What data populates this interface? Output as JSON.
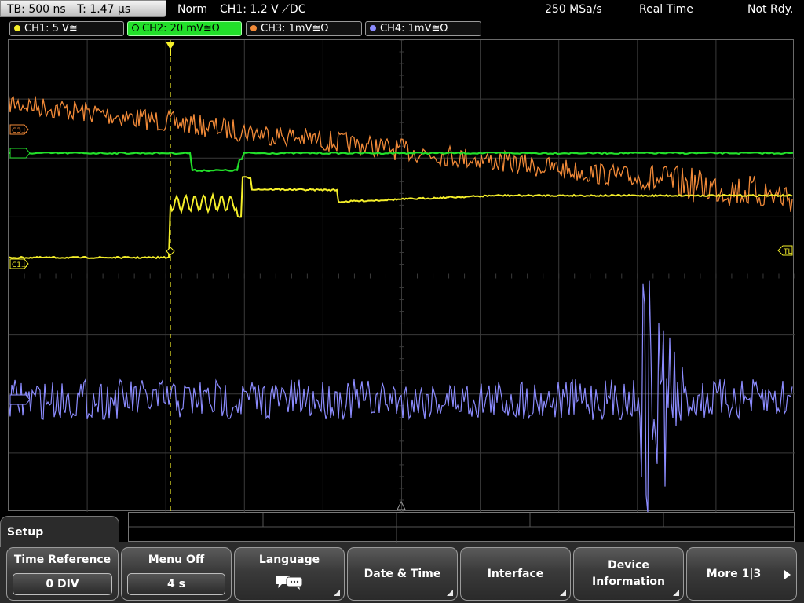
{
  "status": {
    "timebase": "TB: 500 ns",
    "trigger_time": "T: 1.47 µs",
    "trigger_mode": "Norm",
    "trigger_source": "CH1: 1.2 V ⟋DC",
    "sample_rate": "250 MSa/s",
    "acq_mode": "Real Time",
    "state": "Not Rdy."
  },
  "channels": [
    {
      "label": "CH1: 5 V≅",
      "color": "#f5ef2a"
    },
    {
      "label": "CH2: 20 mV≅Ω",
      "color": "#22e02a"
    },
    {
      "label": "CH3: 1mV≅Ω",
      "color": "#f28a38"
    },
    {
      "label": "CH4: 1mV≅Ω",
      "color": "#8c8cff"
    }
  ],
  "markers": {
    "c3": "C3⊥",
    "c1": "C1⊥",
    "tl": "TL"
  },
  "setup": {
    "title": "Setup",
    "time_reference": {
      "label": "Time Reference",
      "value": "0 DIV"
    },
    "menu_off": {
      "label": "Menu Off",
      "value": "4 s"
    },
    "language": {
      "label": "Language"
    },
    "date_time": {
      "label": "Date & Time"
    },
    "interface": {
      "label": "Interface"
    },
    "device_info": {
      "label_line1": "Device",
      "label_line2": "Information"
    },
    "more": {
      "label": "More 1|3"
    }
  },
  "colors": {
    "background": "#000000",
    "grid": "#3a3a3a",
    "ch1": "#f5ef2a",
    "ch2": "#22e02a",
    "ch3": "#f28a38",
    "ch4": "#8c8cff"
  }
}
